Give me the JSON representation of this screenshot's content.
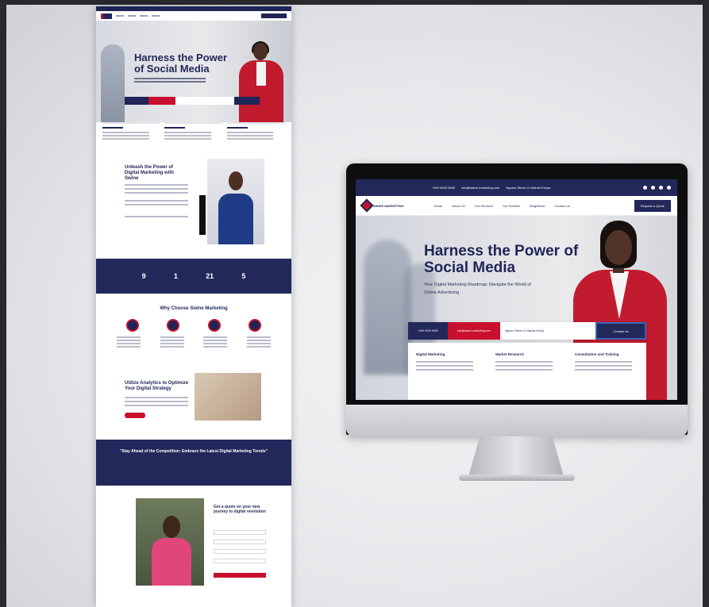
{
  "mockup_long": {
    "hero_title": "Harness the Power of Social Media",
    "about_title": "Unleash the Power of Digital Marketing with Swine",
    "stats": [
      "9",
      "1",
      "21",
      "5"
    ],
    "why_title": "Why Choose Swine Marketing",
    "analytics_title": "Utilize Analytics to Optimize Your Digital Strategy",
    "cta_text": "\"Stay Ahead of the Competition: Embrace the Latest Digital Marketing Trends\"",
    "quote_title": "Get a quote on your new journey to digital revolution"
  },
  "monitor": {
    "topbar": {
      "phone": "+254 0000 0000",
      "email": "info@swine-marketing.com",
      "address": "Ngumo Street 11 Nairobi Kenya",
      "social_icons": [
        "facebook-icon",
        "instagram-icon",
        "twitter-icon",
        "linkedin-icon"
      ]
    },
    "nav": {
      "logo_text": "SWINE MARKETING",
      "links": [
        "Home",
        "About Us",
        "Our Services",
        "Our Portfolio",
        "Blog/News",
        "Contact Us"
      ],
      "cta": "Request a Quote"
    },
    "hero": {
      "title": "Harness the Power of Social Media",
      "subtitle": "Your Digital Marketing Roadmap: Navigate the World of Online Advertising",
      "strip_phone": "+254 0000 0000",
      "strip_email": "info@swine-marketing.com",
      "strip_address": "Ngumo Street 11 Nairobi Kenya",
      "strip_button": "Contact us"
    },
    "cards": [
      {
        "title": "Digital Marketing"
      },
      {
        "title": "Market Research"
      },
      {
        "title": "Consultation and Training"
      }
    ]
  },
  "colors": {
    "navy": "#1f2556",
    "red": "#c8102e"
  }
}
